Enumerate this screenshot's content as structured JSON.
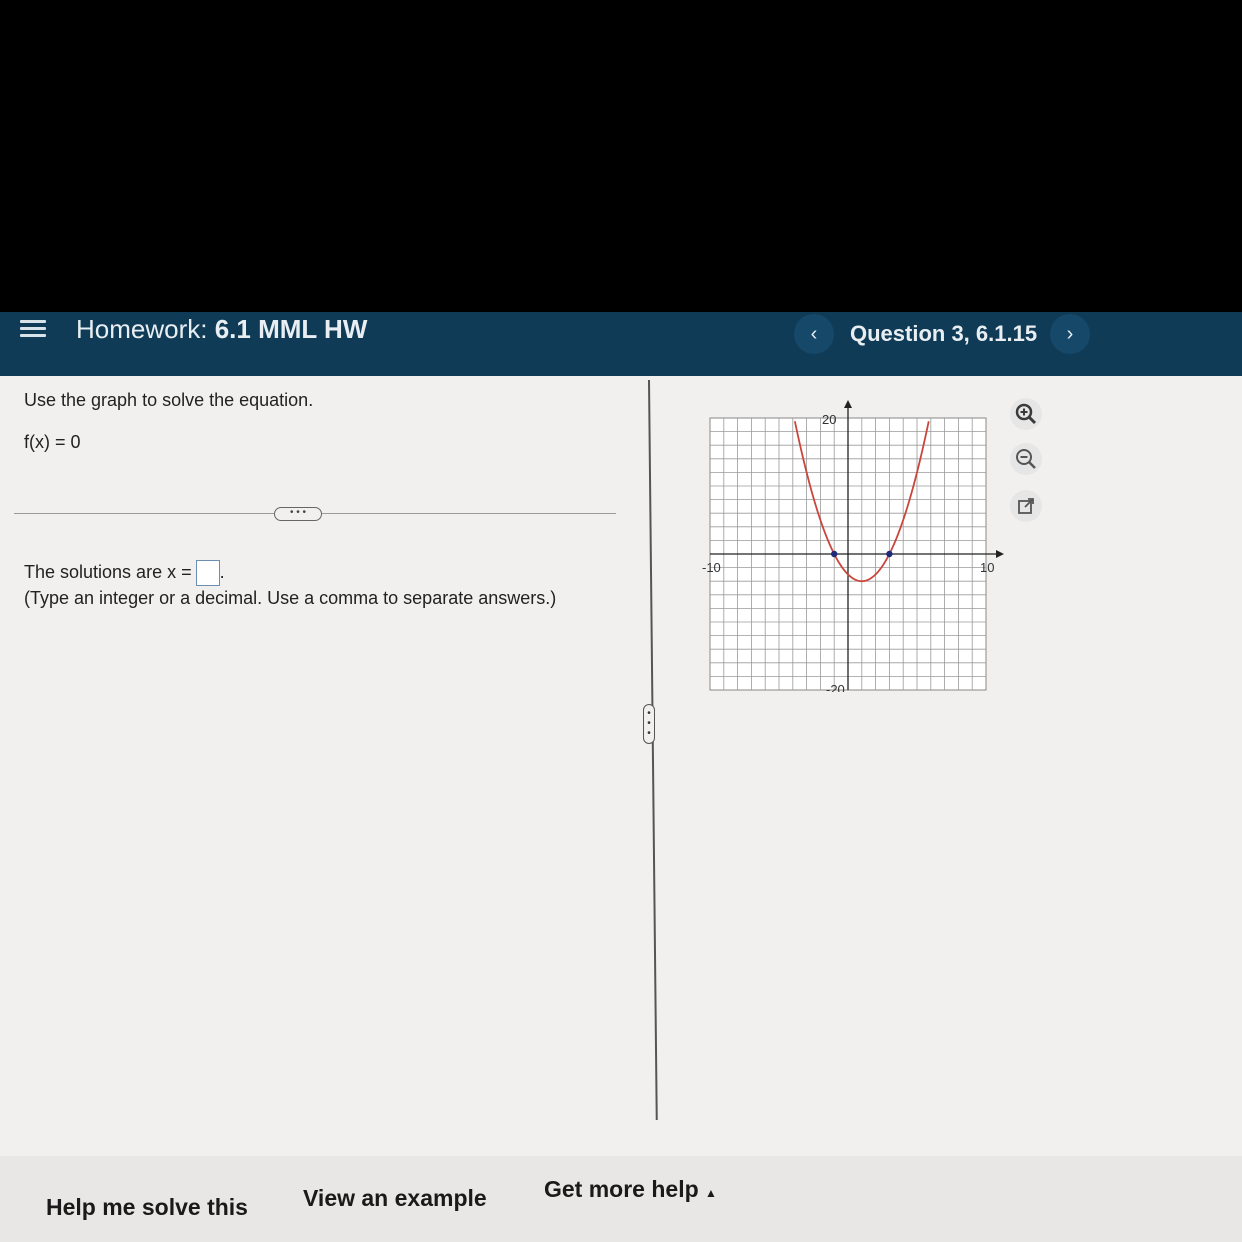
{
  "header": {
    "prefix": "Homework:",
    "assignment": "6.1 MML HW",
    "question": "Question 3, 6.1.15",
    "prev_icon": "chevron-left-icon",
    "next_icon": "chevron-right-icon",
    "menu_icon": "hamburger-menu-icon"
  },
  "problem": {
    "instruction": "Use the graph to solve the equation.",
    "equation": "f(x) = 0",
    "solution_prefix": "The solutions are x =",
    "answer_value": "",
    "hint": "(Type an integer or a decimal. Use a comma to separate answers.)"
  },
  "graph": {
    "x_min": -10,
    "x_max": 10,
    "y_min": -20,
    "y_max": 20,
    "tick_x_min": "-10",
    "tick_x_max": "10",
    "tick_y_max": "20",
    "tick_y_min": "-20",
    "curve_color": "#c9463d",
    "point_color": "#1f2a7a",
    "points": [
      [
        -1,
        0
      ],
      [
        3,
        0
      ]
    ],
    "vertex": [
      1,
      -4
    ]
  },
  "tools": [
    "zoom-in-icon",
    "zoom-out-icon",
    "open-new-window-icon"
  ],
  "footer": {
    "help": "Help me solve this",
    "example": "View an example",
    "more": "Get more help",
    "more_icon": "caret-up-icon"
  }
}
